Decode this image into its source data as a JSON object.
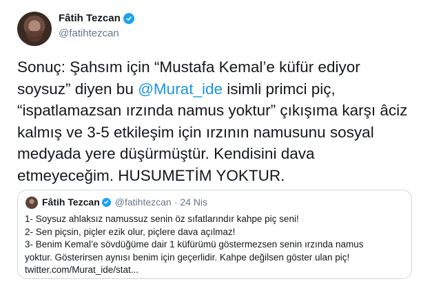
{
  "author": {
    "name": "Fâtih Tezcan",
    "handle": "@fatihtezcan",
    "avatar_icon": "profile-photo",
    "verified_icon": "verified-badge-icon"
  },
  "tweet": {
    "text_before_mention": "Sonuç: Şahsım için “Mustafa Kemal’e küfür ediyor soysuz” diyen bu ",
    "mention": "@Murat_ide",
    "text_after_mention": " isimli primci piç, “ispatlamazsan ırzında namus yoktur” çıkışıma karşı âciz kalmış ve 3-5 etkileşim için ırzının namusunu sosyal medyada yere düşürmüştür. Kendisini dava etmeyeceğim. HUSUMETİM YOKTUR."
  },
  "quoted_tweet": {
    "name": "Fâtih Tezcan",
    "handle": "@fatihtezcan",
    "separator": "·",
    "date": "24 Nis",
    "lines": [
      "1- Soysuz ahlaksız namussuz senin öz sıfatlarındır kahpe piç seni!",
      "2- Sen piçsin, piçler ezik olur, piçlere dava açılmaz!",
      "3- Benim Kemal’e sövdüğüme dair 1 küfürümü göstermezsen senin ırzında namus",
      "yoktur. Gösterirsen aynısı benim için geçerlidir. Kahpe değilsen göster ulan piç!",
      "twitter.com/Murat_ide/stat..."
    ]
  },
  "colors": {
    "text": "#14171a",
    "secondary": "#657786",
    "link": "#1b95e0",
    "verified": "#1da1f2",
    "border": "#ccd6dd"
  }
}
